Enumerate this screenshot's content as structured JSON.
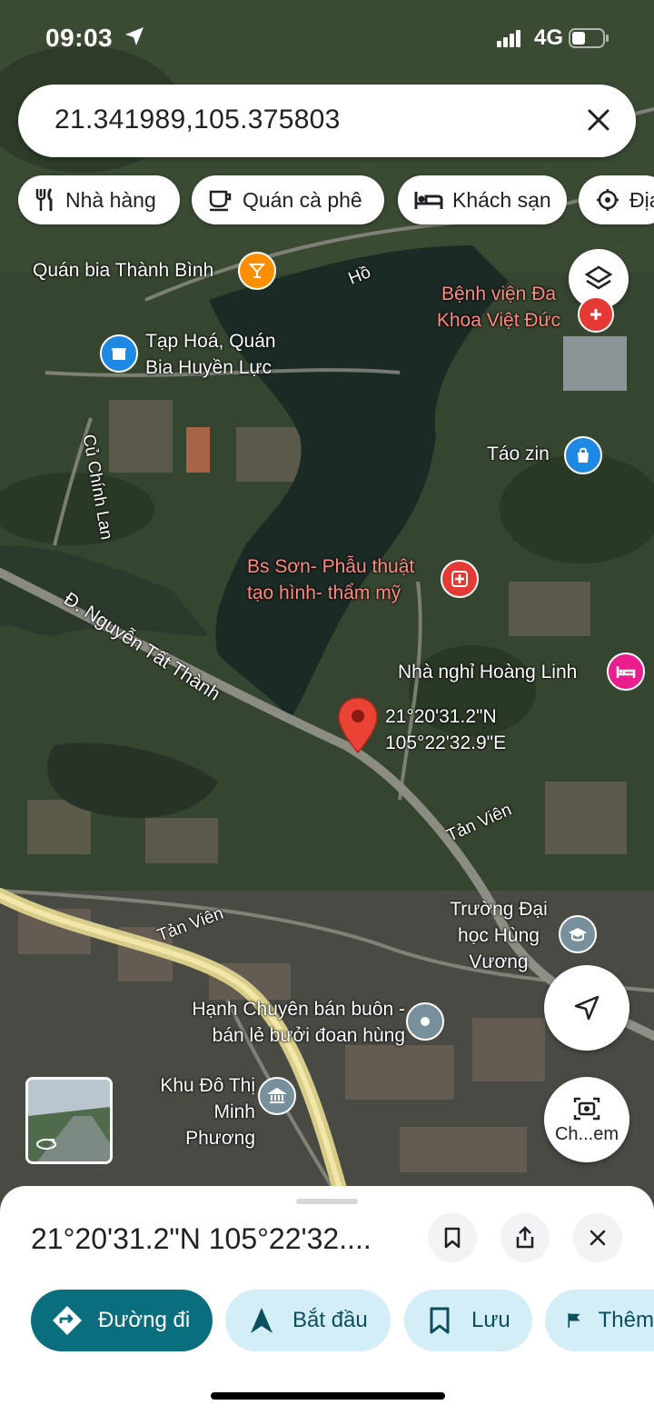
{
  "status_bar": {
    "time": "09:03",
    "network": "4G"
  },
  "search": {
    "query": "21.341989,105.375803"
  },
  "chips": [
    {
      "label": "Nhà hàng",
      "icon": "restaurant-icon"
    },
    {
      "label": "Quán cà phê",
      "icon": "coffee-icon"
    },
    {
      "label": "Khách sạn",
      "icon": "hotel-icon"
    },
    {
      "label": "Địa",
      "icon": "attraction-icon"
    }
  ],
  "map": {
    "water_label": "Hồ",
    "pois": [
      {
        "name": "Quán bia Thành Bình",
        "icon": "bar-icon",
        "color": "#ff8f00"
      },
      {
        "name": "Bệnh viện Đa Khoa Việt Đức",
        "icon": "hospital-icon",
        "color": "#e53935"
      },
      {
        "name": "Tạp Hoá, Quán Bia Huyền Lực",
        "icon": "shop-icon",
        "color": "#1e88e5"
      },
      {
        "name": "Táo zin",
        "icon": "shopping-bag-icon",
        "color": "#1e88e5"
      },
      {
        "name": "Bs Sơn- Phẫu thuật tạo hình- thẩm mỹ",
        "icon": "medical-icon",
        "color": "#e53935"
      },
      {
        "name": "Nhà nghỉ Hoàng Linh",
        "icon": "bed-icon",
        "color": "#e91e8c"
      },
      {
        "name": "Trường Đại học Hùng Vương",
        "icon": "school-icon",
        "color": "#78909c"
      },
      {
        "name": "Hạnh Chuyên bán buôn - bán lẻ bưởi đoan hùng",
        "icon": "place-icon",
        "color": "#78909c"
      },
      {
        "name": "Khu Đô Thị Minh Phương",
        "icon": "government-icon",
        "color": "#78909c"
      }
    ],
    "roads": [
      "Củ Chính Lan",
      "Đ. Nguyễn Tất Thành",
      "Tản Viên",
      "Tản Viên"
    ],
    "dropped_pin": {
      "lat": "21°20'31.2\"N",
      "lng": "105°22'32.9\"E"
    },
    "camera_label": "Ch...em"
  },
  "sheet": {
    "title": "21°20'31.2\"N 105°22'32....",
    "actions": [
      {
        "label": "Đường đi",
        "icon": "directions-icon"
      },
      {
        "label": "Bắt đầu",
        "icon": "navigation-icon"
      },
      {
        "label": "Lưu",
        "icon": "bookmark-icon"
      },
      {
        "label": "Thêm",
        "icon": "flag-icon"
      }
    ]
  },
  "colors": {
    "accent": "#0b6e7f",
    "chip_bg": "#d3eef7",
    "pin": "#ea4335"
  }
}
